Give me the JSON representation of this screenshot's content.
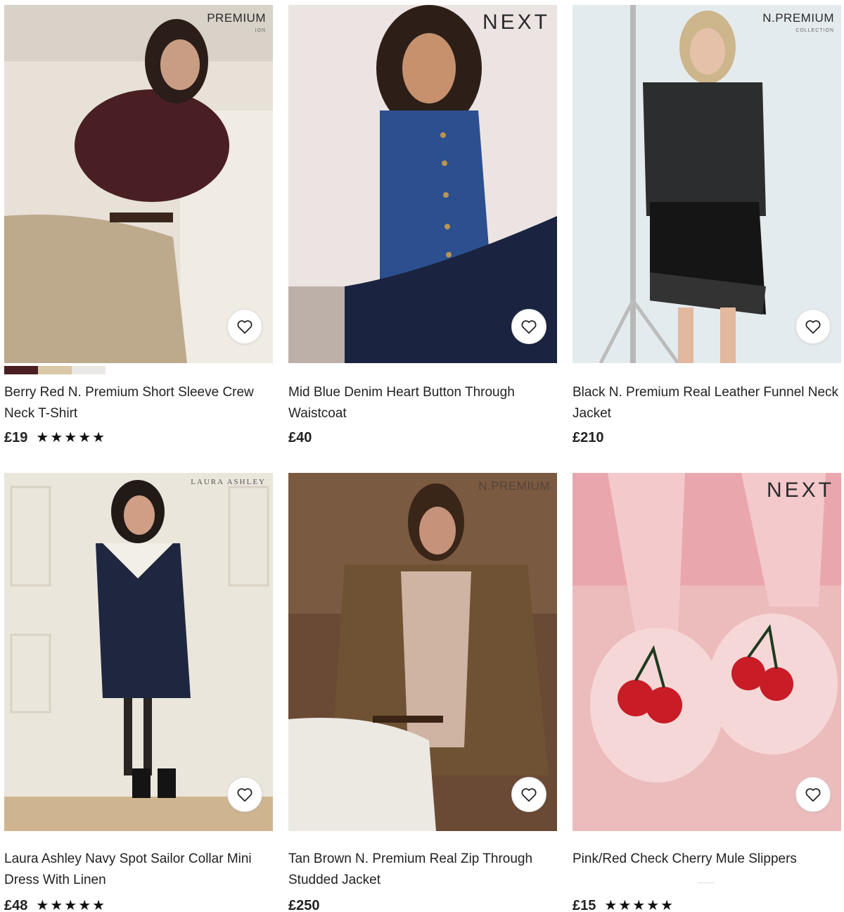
{
  "products": [
    {
      "name": "Berry Red N. Premium Short Sleeve Crew Neck T-Shirt",
      "price": "£19",
      "rating": 5,
      "brand_label": "PREMIUM",
      "brand_sub": "ION",
      "swatches": [
        "#4a1f24",
        "#d9c7a7",
        "#ebe9e5"
      ],
      "bg": "#e8e2d9"
    },
    {
      "name": "Mid Blue Denim Heart Button Through Waistcoat",
      "price": "£40",
      "rating": null,
      "brand_label": "NEXT",
      "bg": "#ece4e2"
    },
    {
      "name": "Black N. Premium Real Leather Funnel Neck Jacket",
      "price": "£210",
      "rating": null,
      "brand_label": "N.PREMIUM",
      "brand_sub": "COLLECTION",
      "bg": "#e4ebee"
    },
    {
      "name": "Laura Ashley Navy Spot Sailor Collar Mini Dress With Linen",
      "price": "£48",
      "rating": 5,
      "brand_label": "LAURA ASHLEY",
      "bg": "#ebe6dc"
    },
    {
      "name": "Tan Brown N. Premium Real Zip Through Studded Jacket",
      "price": "£250",
      "rating": null,
      "brand_label": "N.PREMIUM",
      "bg": "#6b4a35"
    },
    {
      "name": "Pink/Red Check Cherry Mule Slippers",
      "price": "£15",
      "rating": 5,
      "brand_label": "NEXT",
      "bg": "#ecbcbc"
    }
  ],
  "icons": {
    "favourite": "heart-outline-icon",
    "rating": "star-icon"
  }
}
